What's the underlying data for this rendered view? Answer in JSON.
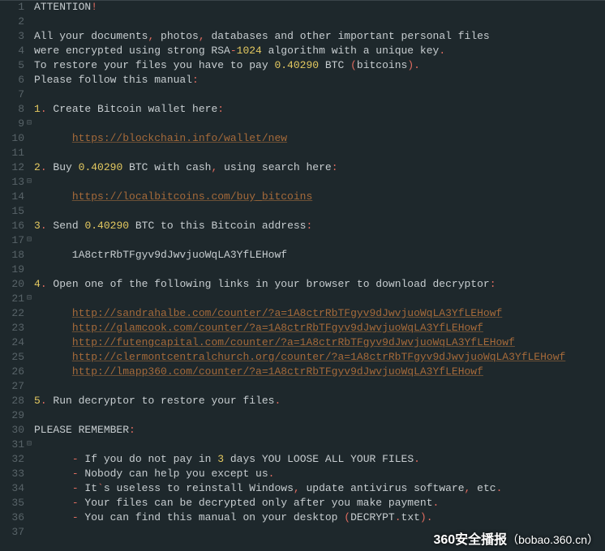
{
  "watermark": {
    "prefix": "360安全播报",
    "suffix": "（bobao.360.cn）"
  },
  "fold_marks": {
    "9": "⊟",
    "13": "⊟",
    "17": "⊟",
    "21": "⊟",
    "31": "⊟"
  },
  "lines": [
    {
      "n": 1,
      "segs": [
        {
          "t": "ATTENTION",
          "c": ""
        },
        {
          "t": "!",
          "c": "punc"
        }
      ]
    },
    {
      "n": 2,
      "segs": []
    },
    {
      "n": 3,
      "segs": [
        {
          "t": "All your documents",
          "c": ""
        },
        {
          "t": ",",
          "c": "punc"
        },
        {
          "t": " photos",
          "c": ""
        },
        {
          "t": ",",
          "c": "punc"
        },
        {
          "t": " databases and other important personal files",
          "c": ""
        }
      ]
    },
    {
      "n": 4,
      "segs": [
        {
          "t": "were encrypted using strong RSA",
          "c": ""
        },
        {
          "t": "-",
          "c": "punc"
        },
        {
          "t": "1024",
          "c": "hl"
        },
        {
          "t": " algorithm with a unique key",
          "c": ""
        },
        {
          "t": ".",
          "c": "punc"
        }
      ]
    },
    {
      "n": 5,
      "segs": [
        {
          "t": "To restore your files you have to pay ",
          "c": ""
        },
        {
          "t": "0.40290",
          "c": "hl"
        },
        {
          "t": " BTC ",
          "c": ""
        },
        {
          "t": "(",
          "c": "punc"
        },
        {
          "t": "bitcoins",
          "c": ""
        },
        {
          "t": ").",
          "c": "punc"
        }
      ]
    },
    {
      "n": 6,
      "segs": [
        {
          "t": "Please follow this manual",
          "c": ""
        },
        {
          "t": ":",
          "c": "punc"
        }
      ]
    },
    {
      "n": 7,
      "segs": []
    },
    {
      "n": 8,
      "segs": [
        {
          "t": "1",
          "c": "hl"
        },
        {
          "t": ".",
          "c": "punc"
        },
        {
          "t": " Create Bitcoin wallet here",
          "c": ""
        },
        {
          "t": ":",
          "c": "punc"
        }
      ]
    },
    {
      "n": 9,
      "segs": []
    },
    {
      "n": 10,
      "segs": [
        {
          "t": "      ",
          "c": ""
        },
        {
          "t": "https://blockchain.info/wallet/new",
          "c": "link"
        }
      ]
    },
    {
      "n": 11,
      "segs": []
    },
    {
      "n": 12,
      "segs": [
        {
          "t": "2",
          "c": "hl"
        },
        {
          "t": ".",
          "c": "punc"
        },
        {
          "t": " Buy ",
          "c": ""
        },
        {
          "t": "0.40290",
          "c": "hl"
        },
        {
          "t": " BTC with cash",
          "c": ""
        },
        {
          "t": ",",
          "c": "punc"
        },
        {
          "t": " using search here",
          "c": ""
        },
        {
          "t": ":",
          "c": "punc"
        }
      ]
    },
    {
      "n": 13,
      "segs": []
    },
    {
      "n": 14,
      "segs": [
        {
          "t": "      ",
          "c": ""
        },
        {
          "t": "https://localbitcoins.com/buy_bitcoins",
          "c": "link"
        }
      ]
    },
    {
      "n": 15,
      "segs": []
    },
    {
      "n": 16,
      "segs": [
        {
          "t": "3",
          "c": "hl"
        },
        {
          "t": ".",
          "c": "punc"
        },
        {
          "t": " Send ",
          "c": ""
        },
        {
          "t": "0.40290",
          "c": "hl"
        },
        {
          "t": " BTC to this Bitcoin address",
          "c": ""
        },
        {
          "t": ":",
          "c": "punc"
        }
      ]
    },
    {
      "n": 17,
      "segs": []
    },
    {
      "n": 18,
      "segs": [
        {
          "t": "      1A8ctrRbTFgyv9dJwvjuoWqLA3YfLEHowf",
          "c": ""
        }
      ]
    },
    {
      "n": 19,
      "segs": []
    },
    {
      "n": 20,
      "segs": [
        {
          "t": "4",
          "c": "hl"
        },
        {
          "t": ".",
          "c": "punc"
        },
        {
          "t": " Open one of the following links in your browser to download decryptor",
          "c": ""
        },
        {
          "t": ":",
          "c": "punc"
        }
      ]
    },
    {
      "n": 21,
      "segs": []
    },
    {
      "n": 22,
      "segs": [
        {
          "t": "      ",
          "c": ""
        },
        {
          "t": "http://sandrahalbe.com/counter/?a=1A8ctrRbTFgyv9dJwvjuoWqLA3YfLEHowf",
          "c": "link"
        }
      ]
    },
    {
      "n": 23,
      "segs": [
        {
          "t": "      ",
          "c": ""
        },
        {
          "t": "http://glamcook.com/counter/?a=1A8ctrRbTFgyv9dJwvjuoWqLA3YfLEHowf",
          "c": "link"
        }
      ]
    },
    {
      "n": 24,
      "segs": [
        {
          "t": "      ",
          "c": ""
        },
        {
          "t": "http://futengcapital.com/counter/?a=1A8ctrRbTFgyv9dJwvjuoWqLA3YfLEHowf",
          "c": "link"
        }
      ]
    },
    {
      "n": 25,
      "segs": [
        {
          "t": "      ",
          "c": ""
        },
        {
          "t": "http://clermontcentralchurch.org/counter/?a=1A8ctrRbTFgyv9dJwvjuoWqLA3YfLEHowf",
          "c": "link"
        }
      ]
    },
    {
      "n": 26,
      "segs": [
        {
          "t": "      ",
          "c": ""
        },
        {
          "t": "http://lmapp360.com/counter/?a=1A8ctrRbTFgyv9dJwvjuoWqLA3YfLEHowf",
          "c": "link"
        }
      ]
    },
    {
      "n": 27,
      "segs": []
    },
    {
      "n": 28,
      "segs": [
        {
          "t": "5",
          "c": "hl"
        },
        {
          "t": ".",
          "c": "punc"
        },
        {
          "t": " Run decryptor to restore your files",
          "c": ""
        },
        {
          "t": ".",
          "c": "punc"
        }
      ]
    },
    {
      "n": 29,
      "segs": []
    },
    {
      "n": 30,
      "segs": [
        {
          "t": "PLEASE REMEMBER",
          "c": ""
        },
        {
          "t": ":",
          "c": "punc"
        }
      ]
    },
    {
      "n": 31,
      "segs": []
    },
    {
      "n": 32,
      "segs": [
        {
          "t": "      ",
          "c": ""
        },
        {
          "t": "-",
          "c": "punc"
        },
        {
          "t": " If you do not pay in ",
          "c": ""
        },
        {
          "t": "3",
          "c": "hl"
        },
        {
          "t": " days YOU LOOSE ALL YOUR FILES",
          "c": ""
        },
        {
          "t": ".",
          "c": "punc"
        }
      ]
    },
    {
      "n": 33,
      "segs": [
        {
          "t": "      ",
          "c": ""
        },
        {
          "t": "-",
          "c": "punc"
        },
        {
          "t": " Nobody can help you except us",
          "c": ""
        },
        {
          "t": ".",
          "c": "punc"
        }
      ]
    },
    {
      "n": 34,
      "segs": [
        {
          "t": "      ",
          "c": ""
        },
        {
          "t": "-",
          "c": "punc"
        },
        {
          "t": " It",
          "c": ""
        },
        {
          "t": "`",
          "c": "punc"
        },
        {
          "t": "s useless to reinstall Windows",
          "c": ""
        },
        {
          "t": ",",
          "c": "punc"
        },
        {
          "t": " update antivirus software",
          "c": ""
        },
        {
          "t": ",",
          "c": "punc"
        },
        {
          "t": " etc",
          "c": ""
        },
        {
          "t": ".",
          "c": "punc"
        }
      ]
    },
    {
      "n": 35,
      "segs": [
        {
          "t": "      ",
          "c": ""
        },
        {
          "t": "-",
          "c": "punc"
        },
        {
          "t": " Your files can be decrypted only after you make payment",
          "c": ""
        },
        {
          "t": ".",
          "c": "punc"
        }
      ]
    },
    {
      "n": 36,
      "segs": [
        {
          "t": "      ",
          "c": ""
        },
        {
          "t": "-",
          "c": "punc"
        },
        {
          "t": " You can find this manual on your desktop ",
          "c": ""
        },
        {
          "t": "(",
          "c": "punc"
        },
        {
          "t": "DECRYPT",
          "c": ""
        },
        {
          "t": ".",
          "c": "punc"
        },
        {
          "t": "txt",
          "c": ""
        },
        {
          "t": ").",
          "c": "punc"
        }
      ]
    },
    {
      "n": 37,
      "segs": []
    }
  ]
}
